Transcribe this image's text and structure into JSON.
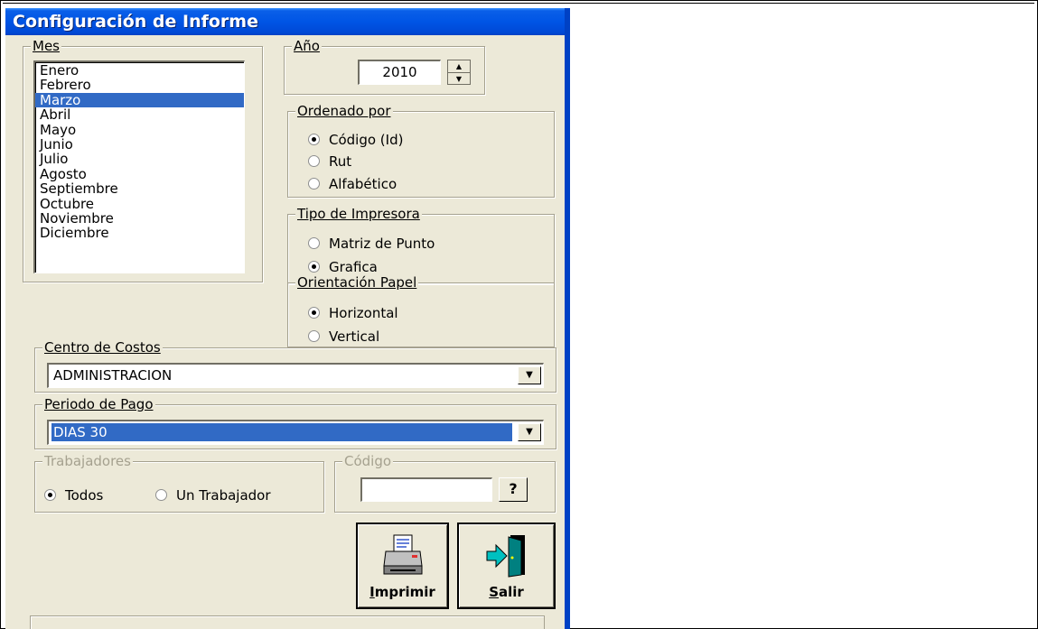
{
  "window": {
    "title": "Configuración de Informe"
  },
  "mes": {
    "label": "Mes",
    "items": [
      "Enero",
      "Febrero",
      "Marzo",
      "Abril",
      "Mayo",
      "Junio",
      "Julio",
      "Agosto",
      "Septiembre",
      "Octubre",
      "Noviembre",
      "Diciembre"
    ],
    "selected": "Marzo"
  },
  "anio": {
    "label": "Año",
    "value": "2010"
  },
  "ordenado": {
    "label": "Ordenado por",
    "options": [
      "Código (Id)",
      "Rut",
      "Alfabético"
    ],
    "selected": "Código (Id)"
  },
  "impresora": {
    "label": "Tipo de Impresora",
    "options": [
      "Matriz de Punto",
      "Grafica"
    ],
    "selected": "Grafica"
  },
  "orientacion": {
    "label": "Orientación Papel",
    "options": [
      "Horizontal",
      "Vertical"
    ],
    "selected": "Horizontal"
  },
  "centro": {
    "label": "Centro de Costos",
    "value": "ADMINISTRACION"
  },
  "periodo": {
    "label": "Periodo de Pago",
    "value": "DIAS 30"
  },
  "trabajadores": {
    "label": "Trabajadores",
    "options": [
      "Todos",
      "Un Trabajador"
    ],
    "selected": "Todos"
  },
  "codigo": {
    "label": "Código",
    "value": "",
    "help_label": "?"
  },
  "buttons": {
    "print": {
      "accel": "I",
      "rest": "mprimir"
    },
    "exit": {
      "accel": "S",
      "rest": "alir"
    }
  },
  "colors": {
    "titlebar": "#0055e5",
    "selection": "#316ac5",
    "face": "#ece9d8"
  }
}
